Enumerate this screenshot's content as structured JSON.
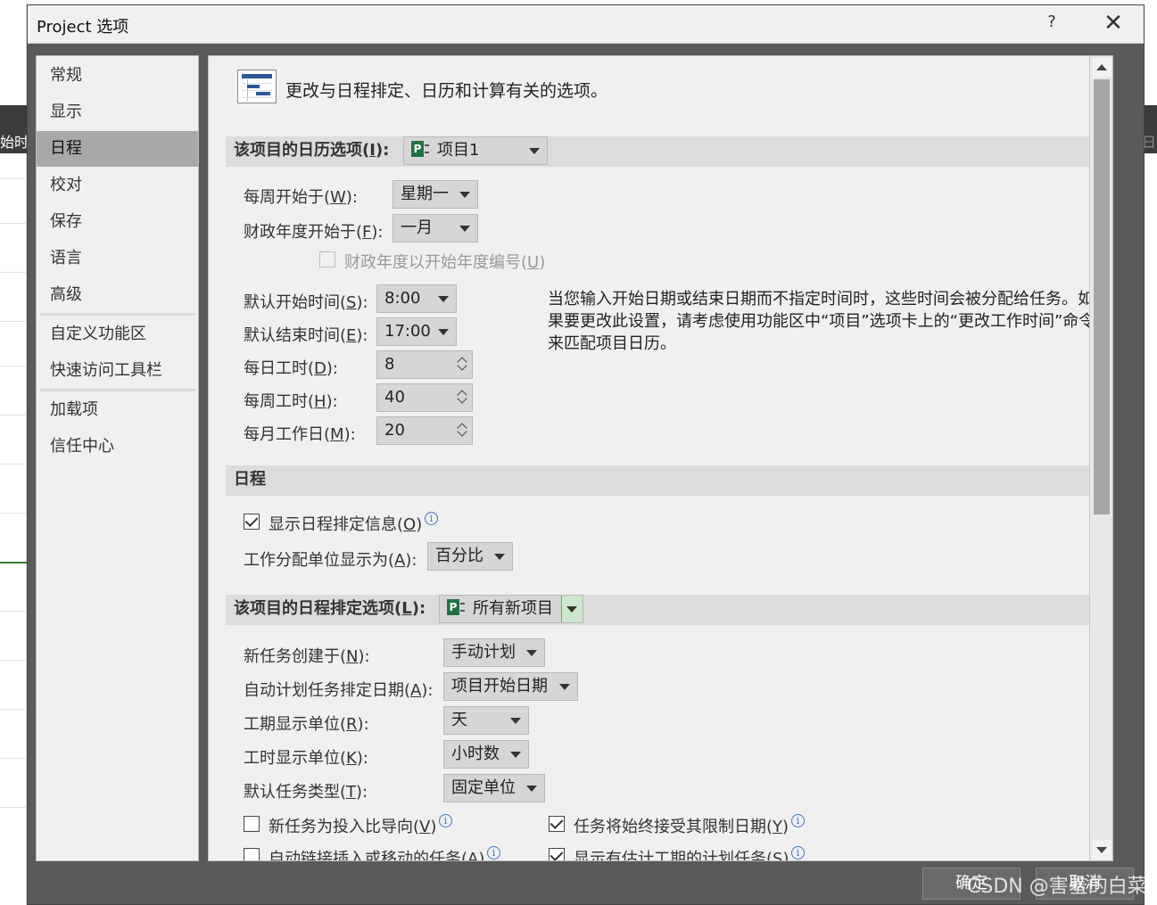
{
  "background": {
    "left_header_text": "始时",
    "right_header_text": "日"
  },
  "window": {
    "title": "Project 选项",
    "help_label": "?",
    "close_label": "✕"
  },
  "sidebar": {
    "items": [
      {
        "label": "常规"
      },
      {
        "label": "显示"
      },
      {
        "label": "日程",
        "active": true
      },
      {
        "label": "校对"
      },
      {
        "label": "保存"
      },
      {
        "label": "语言"
      },
      {
        "label": "高级"
      },
      {
        "label": "自定义功能区"
      },
      {
        "label": "快速访问工具栏"
      },
      {
        "label": "加载项"
      },
      {
        "label": "信任中心"
      }
    ]
  },
  "header": {
    "icon": "schedule-icon",
    "text": "更改与日程排定、日历和计算有关的选项。"
  },
  "calendar_section": {
    "title_prefix": "该项目的日历选项(",
    "title_key": "I",
    "title_suffix": "):",
    "project_dropdown": "项目1",
    "week_start": {
      "label_prefix": "每周开始于(",
      "key": "W",
      "label_suffix": "):",
      "value": "星期一"
    },
    "fiscal_start": {
      "label_prefix": "财政年度开始于(",
      "key": "F",
      "label_suffix": "):",
      "value": "一月"
    },
    "fiscal_numbering": {
      "label_prefix": "财政年度以开始年度编号(",
      "key": "U",
      "label_suffix": ")",
      "checked": false,
      "disabled": true
    },
    "default_start": {
      "label_prefix": "默认开始时间(",
      "key": "S",
      "label_suffix": "):",
      "value": "8:00"
    },
    "default_end": {
      "label_prefix": "默认结束时间(",
      "key": "E",
      "label_suffix": "):",
      "value": "17:00"
    },
    "hours_per_day": {
      "label_prefix": "每日工时(",
      "key": "D",
      "label_suffix": "):",
      "value": "8"
    },
    "hours_per_week": {
      "label_prefix": "每周工时(",
      "key": "H",
      "label_suffix": "):",
      "value": "40"
    },
    "days_per_month": {
      "label_prefix": "每月工作日(",
      "key": "M",
      "label_suffix": "):",
      "value": "20"
    },
    "note": "当您输入开始日期或结束日期而不指定时间时，这些时间会被分配给任务。如果要更改此设置，请考虑使用功能区中“项目”选项卡上的“更改工作时间”命令来匹配项目日历。"
  },
  "schedule_section": {
    "title": "日程",
    "show_info": {
      "label_prefix": "显示日程排定信息(",
      "key": "O",
      "label_suffix": ")",
      "checked": true
    },
    "assignment_units": {
      "label_prefix": "工作分配单位显示为(",
      "key": "A",
      "label_suffix": "):",
      "value": "百分比"
    }
  },
  "scheduling_options": {
    "title_prefix": "该项目的日程排定选项(",
    "title_key": "L",
    "title_suffix": "):",
    "project_dropdown": "所有新项目",
    "new_tasks": {
      "label_prefix": "新任务创建于(",
      "key": "N",
      "label_suffix": "):",
      "value": "手动计划"
    },
    "auto_scheduled": {
      "label_prefix": "自动计划任务排定日期(",
      "key": "A",
      "label_suffix": "):",
      "value": "项目开始日期"
    },
    "duration_unit": {
      "label_prefix": "工期显示单位(",
      "key": "R",
      "label_suffix": "):",
      "value": "天"
    },
    "work_unit": {
      "label_prefix": "工时显示单位(",
      "key": "K",
      "label_suffix": "):",
      "value": "小时数"
    },
    "task_type": {
      "label_prefix": "默认任务类型(",
      "key": "T",
      "label_suffix": "):",
      "value": "固定单位"
    },
    "effort_driven": {
      "label_prefix": "新任务为投入比导向(",
      "key": "V",
      "label_suffix": ")",
      "checked": false
    },
    "honor_constraints": {
      "label_prefix": "任务将始终接受其限制日期(",
      "key": "Y",
      "label_suffix": ")",
      "checked": true
    },
    "autolink": {
      "label_prefix": "自动链接插入或移动的任务(",
      "key": "A",
      "label_suffix": ")",
      "checked": false
    },
    "estimated_durations": {
      "label_prefix": "显示有估计工期的计划任务(",
      "key": "S",
      "label_suffix": ")",
      "checked": true
    }
  },
  "footer": {
    "ok_label": "确定",
    "cancel_label": "取消",
    "watermark": "CSDN @害羞的白菜"
  }
}
